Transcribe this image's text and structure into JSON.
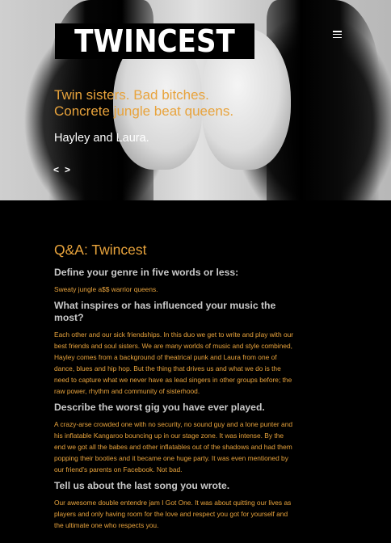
{
  "hero": {
    "logo_text": "TWINCEST",
    "tagline_line1": "Twin sisters. Bad bitches.",
    "tagline_line2": "Concrete jungle beat queens.",
    "subline": "Hayley and Laura.",
    "prev_arrow": "<",
    "next_arrow": ">"
  },
  "menu": {
    "icon": "hamburger-menu-icon"
  },
  "article": {
    "title": "Q&A: Twincest",
    "qa": [
      {
        "question": "Define your genre in five words or less:",
        "answer": "Sweaty jungle a$$ warrior queens."
      },
      {
        "question": "What inspires or has influenced your music the most?",
        "answer": "Each other and our sick friendships. In this duo we get to write and play with our best friends and soul sisters. We are many worlds of music and style combined, Hayley comes from a background of theatrical punk and Laura from one of dance, blues and hip hop. But the thing that drives us and what we do is the need to capture what we never have as lead singers in other groups before; the raw power, rhythm and community of sisterhood."
      },
      {
        "question": "Describe the worst gig you have ever played.",
        "answer": "A crazy-arse crowded one with no security, no sound guy and a lone punter and his inflatable Kangaroo bouncing up in our stage zone. It was intense. By the end we got all the babes and other inflatables out of the shadows and had them popping their booties and it became one huge party. It was even mentioned by our friend's parents on Facebook. Not bad."
      },
      {
        "question": "Tell us about the last song you wrote.",
        "answer": "Our awesome double entendre jam I Got One. It was about quitting our lives as players and only having room for the love and respect you got for yourself and the ultimate one who respects you."
      }
    ]
  },
  "colors": {
    "accent": "#e8a33c",
    "background": "#000000",
    "question_text": "#c9c9c9"
  }
}
